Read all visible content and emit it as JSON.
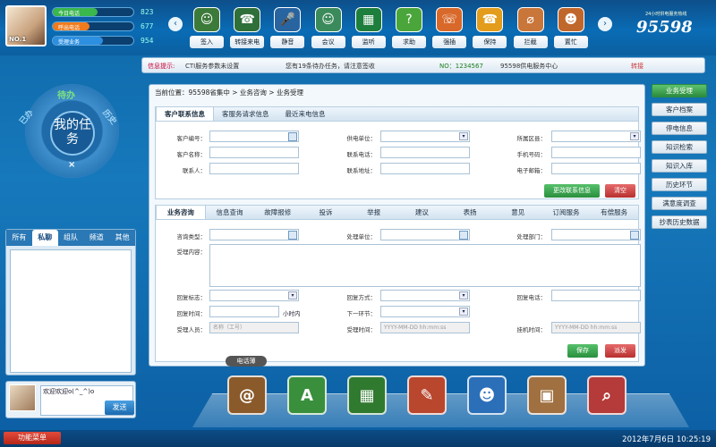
{
  "user": {
    "badge": "NO.1"
  },
  "stats": [
    {
      "label": "今日电话",
      "value": "823",
      "fill": 0.55,
      "color": "#3ab74d"
    },
    {
      "label": "呼出电话",
      "value": "677",
      "fill": 0.45,
      "color": "#f07b1c"
    },
    {
      "label": "受理业务",
      "value": "954",
      "fill": 0.62,
      "color": "#2d8fe0"
    }
  ],
  "toolbar": [
    {
      "label": "签入",
      "icon": "sign-in-icon",
      "glyph": "☺",
      "color": "#3c7a3a"
    },
    {
      "label": "转接来电",
      "icon": "phone-keypad-icon",
      "glyph": "☎",
      "color": "#2f6f3a"
    },
    {
      "label": "静音",
      "icon": "microphone-icon",
      "glyph": "🎤",
      "color": "#2864a0"
    },
    {
      "label": "会议",
      "icon": "meeting-icon",
      "glyph": "☺",
      "color": "#3b8a5b"
    },
    {
      "label": "监听",
      "icon": "monitor-icon",
      "glyph": "▦",
      "color": "#1e7e3c"
    },
    {
      "label": "求助",
      "icon": "help-icon",
      "glyph": "?",
      "color": "#4aa53a"
    },
    {
      "label": "强插",
      "icon": "insert-call-icon",
      "glyph": "☏",
      "color": "#d8692a"
    },
    {
      "label": "保持",
      "icon": "hold-icon",
      "glyph": "☎",
      "color": "#e39c1c"
    },
    {
      "label": "拦截",
      "icon": "intercept-icon",
      "glyph": "⌀",
      "color": "#c9763a"
    },
    {
      "label": "置忙",
      "icon": "busy-icon",
      "glyph": "☻",
      "color": "#c0672c"
    }
  ],
  "logo": {
    "number": "95598",
    "tagline": "24小时供电服务热线"
  },
  "info": {
    "label": "信息提示:",
    "msg1": "CTI服务参数未设置",
    "msg2": "您有19条待办任务，请注意签收",
    "no": "NO：1234567",
    "center": "95598供电服务中心",
    "status": "转接"
  },
  "task_wheel": {
    "top": "待办",
    "left": "已办",
    "right": "历史",
    "center": "我的任务",
    "close": "×"
  },
  "left_tabs": [
    "所有",
    "私聊",
    "组队",
    "频道",
    "其他"
  ],
  "chat": {
    "input_text": "欢迎欢迎o(^_^)o",
    "send": "发送"
  },
  "breadcrumb": "当前位置：95598省集中 > 业务咨询 > 业务受理",
  "sec1": {
    "tabs": [
      "客户联系信息",
      "客服务请求信息",
      "最近来电信息"
    ],
    "fields": {
      "cust_no": "客户编号：",
      "cust_name": "客户名称：",
      "contact": "联系人：",
      "power_unit": "供电单位：",
      "phone": "联系电话：",
      "address": "联系地址：",
      "region": "所属区县：",
      "mobile": "手机号码：",
      "email": "电子邮箱："
    },
    "btn_change": "更改联系信息",
    "btn_clear": "清空"
  },
  "sec2": {
    "tabs": [
      "业务咨询",
      "信息查询",
      "故障报修",
      "投诉",
      "举报",
      "建议",
      "表扬",
      "意见",
      "订阅服务",
      "有偿服务"
    ],
    "fields": {
      "consult_type": "咨询类型：",
      "handle_unit": "处理单位：",
      "handle_dept": "处理部门：",
      "content": "受理内容：",
      "reply_flag": "回复标志：",
      "reply_mode": "回复方式：",
      "reply_phone": "回复电话：",
      "reply_time": "回复时间：",
      "hours": "小时内",
      "next_step": "下一环节：",
      "handler": "受理人员：",
      "handler_ph": "名称（工号）",
      "accept_time": "受理时间：",
      "hangup_time": "挂机时间：",
      "time_ph": "YYYY-MM-DD hh:mm:ss"
    },
    "btn_save": "保存",
    "btn_dispatch": "派发"
  },
  "right_nav": [
    "业务受理",
    "客户档案",
    "停电信息",
    "知识检索",
    "知识入库",
    "历史环节",
    "满意度调查",
    "抄表历史数据"
  ],
  "dock": {
    "phonebook": "电话薄",
    "icons": [
      {
        "name": "address-book-icon",
        "glyph": "@",
        "color": "#8a5a2b"
      },
      {
        "name": "map-icon",
        "glyph": "A",
        "color": "#3a8f3c"
      },
      {
        "name": "book-store-icon",
        "glyph": "▦",
        "color": "#2f7a2f"
      },
      {
        "name": "calendar-note-icon",
        "glyph": "✎",
        "color": "#b8472e"
      },
      {
        "name": "contacts-icon",
        "glyph": "☻",
        "color": "#2b6fb8"
      },
      {
        "name": "my-task-icon",
        "glyph": "▣",
        "color": "#a07040"
      },
      {
        "name": "search-book-icon",
        "glyph": "⌕",
        "color": "#b53a3a"
      }
    ]
  },
  "footer": {
    "menu": "功能菜单",
    "datetime": "2012年7月6日  10:25:19"
  }
}
